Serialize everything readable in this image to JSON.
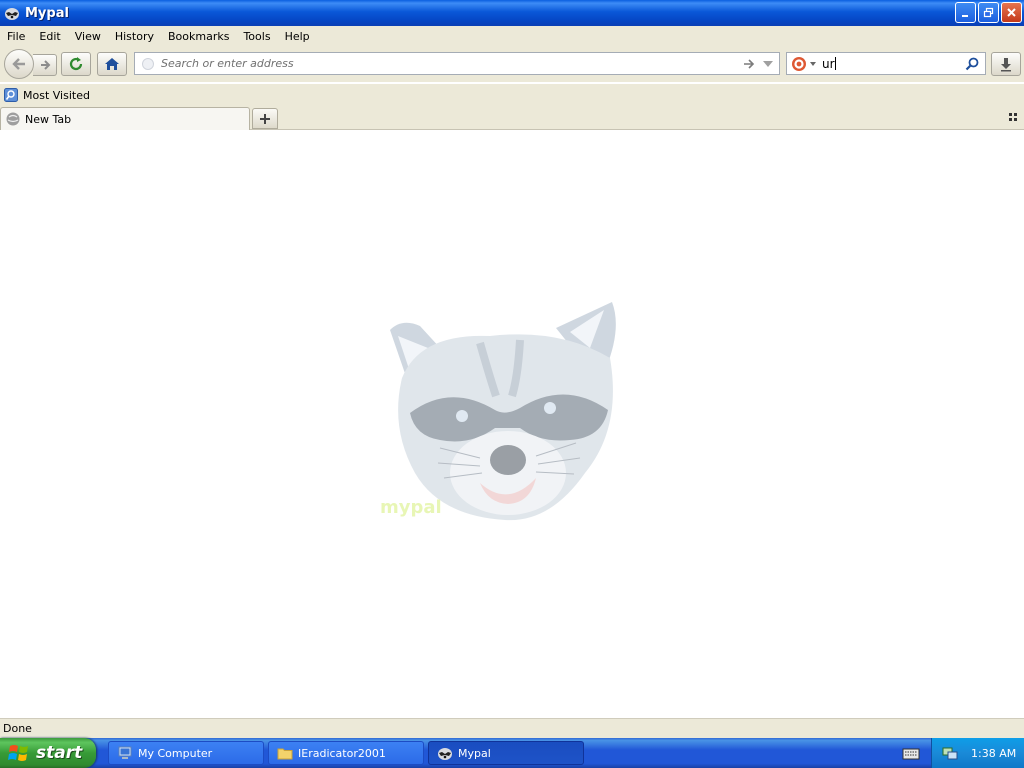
{
  "window": {
    "title": "Mypal"
  },
  "menu": {
    "items": [
      "File",
      "Edit",
      "View",
      "History",
      "Bookmarks",
      "Tools",
      "Help"
    ]
  },
  "navbar": {
    "url_placeholder": "Search or enter address",
    "url_value": "",
    "search_value": "ur"
  },
  "bookmarks": {
    "items": [
      {
        "label": "Most Visited",
        "icon": "most-visited-icon"
      }
    ]
  },
  "tabs": [
    {
      "label": "New Tab",
      "active": true
    }
  ],
  "content": {
    "mascot_caption": "mypal"
  },
  "status": {
    "text": "Done"
  },
  "taskbar": {
    "start_label": "start",
    "tasks": [
      {
        "label": "My Computer",
        "icon": "my-computer-icon",
        "active": false
      },
      {
        "label": "IEradicator2001",
        "icon": "folder-icon",
        "active": false
      },
      {
        "label": "Mypal",
        "icon": "mypal-icon",
        "active": true
      }
    ],
    "clock": "1:38 AM"
  },
  "colors": {
    "titlebar": "#0a58d8",
    "chrome": "#ece9d8",
    "start_green": "#379b37",
    "taskbar_blue": "#2157d7"
  }
}
